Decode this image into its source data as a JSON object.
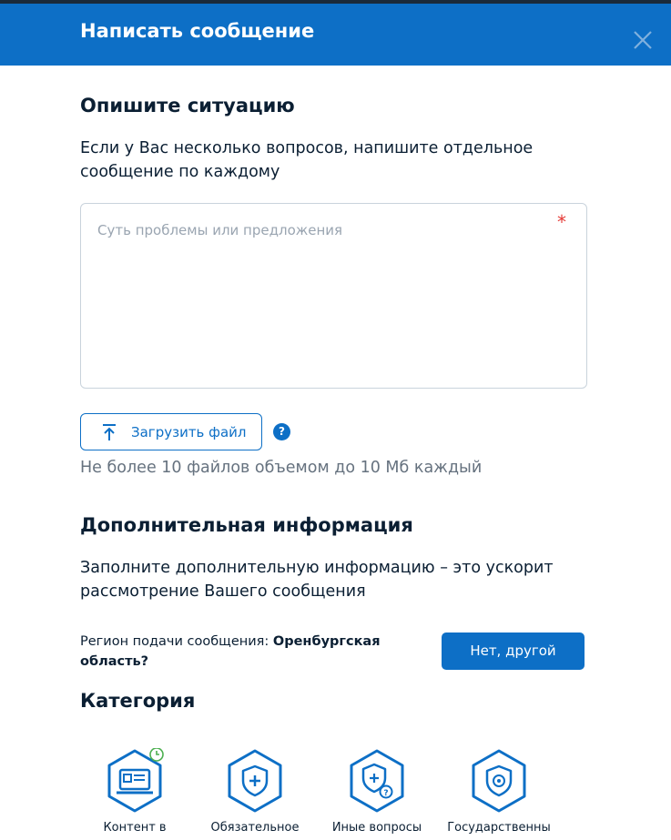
{
  "header": {
    "title": "Написать сообщение"
  },
  "situation": {
    "heading": "Опишите ситуацию",
    "description": "Если у Вас несколько вопросов, напишите отдельное сообщение по каждому",
    "textarea_placeholder": "Суть проблемы или предложения",
    "required_mark": "*"
  },
  "upload": {
    "button_label": "Загрузить файл",
    "help_icon": "?",
    "hint": "Не более 10 файлов объемом до 10 Мб каждый"
  },
  "additional": {
    "heading": "Дополнительная информация",
    "description": "Заполните дополнительную информацию – это ускорит рассмотрение Вашего сообщения"
  },
  "region": {
    "label": "Регион подачи сообщения:",
    "value": "Оренбургская область?",
    "button_label": "Нет, другой"
  },
  "category": {
    "heading": "Категория",
    "items": [
      {
        "label": "Контент в",
        "icon": "laptop-content-icon"
      },
      {
        "label": "Обязательное",
        "icon": "shield-plus-icon"
      },
      {
        "label": "Иные вопросы",
        "icon": "shield-question-icon"
      },
      {
        "label": "Государственны",
        "icon": "shield-emblem-icon"
      }
    ]
  },
  "colors": {
    "brand": "#0d6fc6",
    "text": "#0b1f33",
    "required": "#e53935",
    "badge": "#4caf50"
  }
}
